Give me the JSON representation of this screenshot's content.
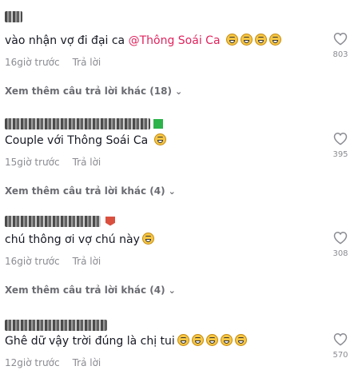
{
  "comments": [
    {
      "text": "vào nhận vợ đi đại ca ",
      "mention": "@Thông Soái Ca",
      "time": "16giờ trước",
      "reply": "Trả lời",
      "likes": "803"
    },
    {
      "text": "Couple với Thông Soái Ca ",
      "time": "15giờ trước",
      "reply": "Trả lời",
      "likes": "395"
    },
    {
      "text": "chú thông ơi vợ chú này",
      "time": "16giờ trước",
      "reply": "Trả lời",
      "likes": "308"
    },
    {
      "text": "Ghê dữ vậy trời đúng là chị tui",
      "time": "12giờ trước",
      "reply": "Trả lời",
      "likes": "570"
    }
  ],
  "more_replies": [
    "Xem thêm câu trả lời khác (18)",
    "Xem thêm câu trả lời khác (4)",
    "Xem thêm câu trả lời khác (4)"
  ],
  "icons": {
    "like": "heart-icon",
    "emoji": "laughing-emoji-icon",
    "expand": "chevron-down-icon"
  }
}
